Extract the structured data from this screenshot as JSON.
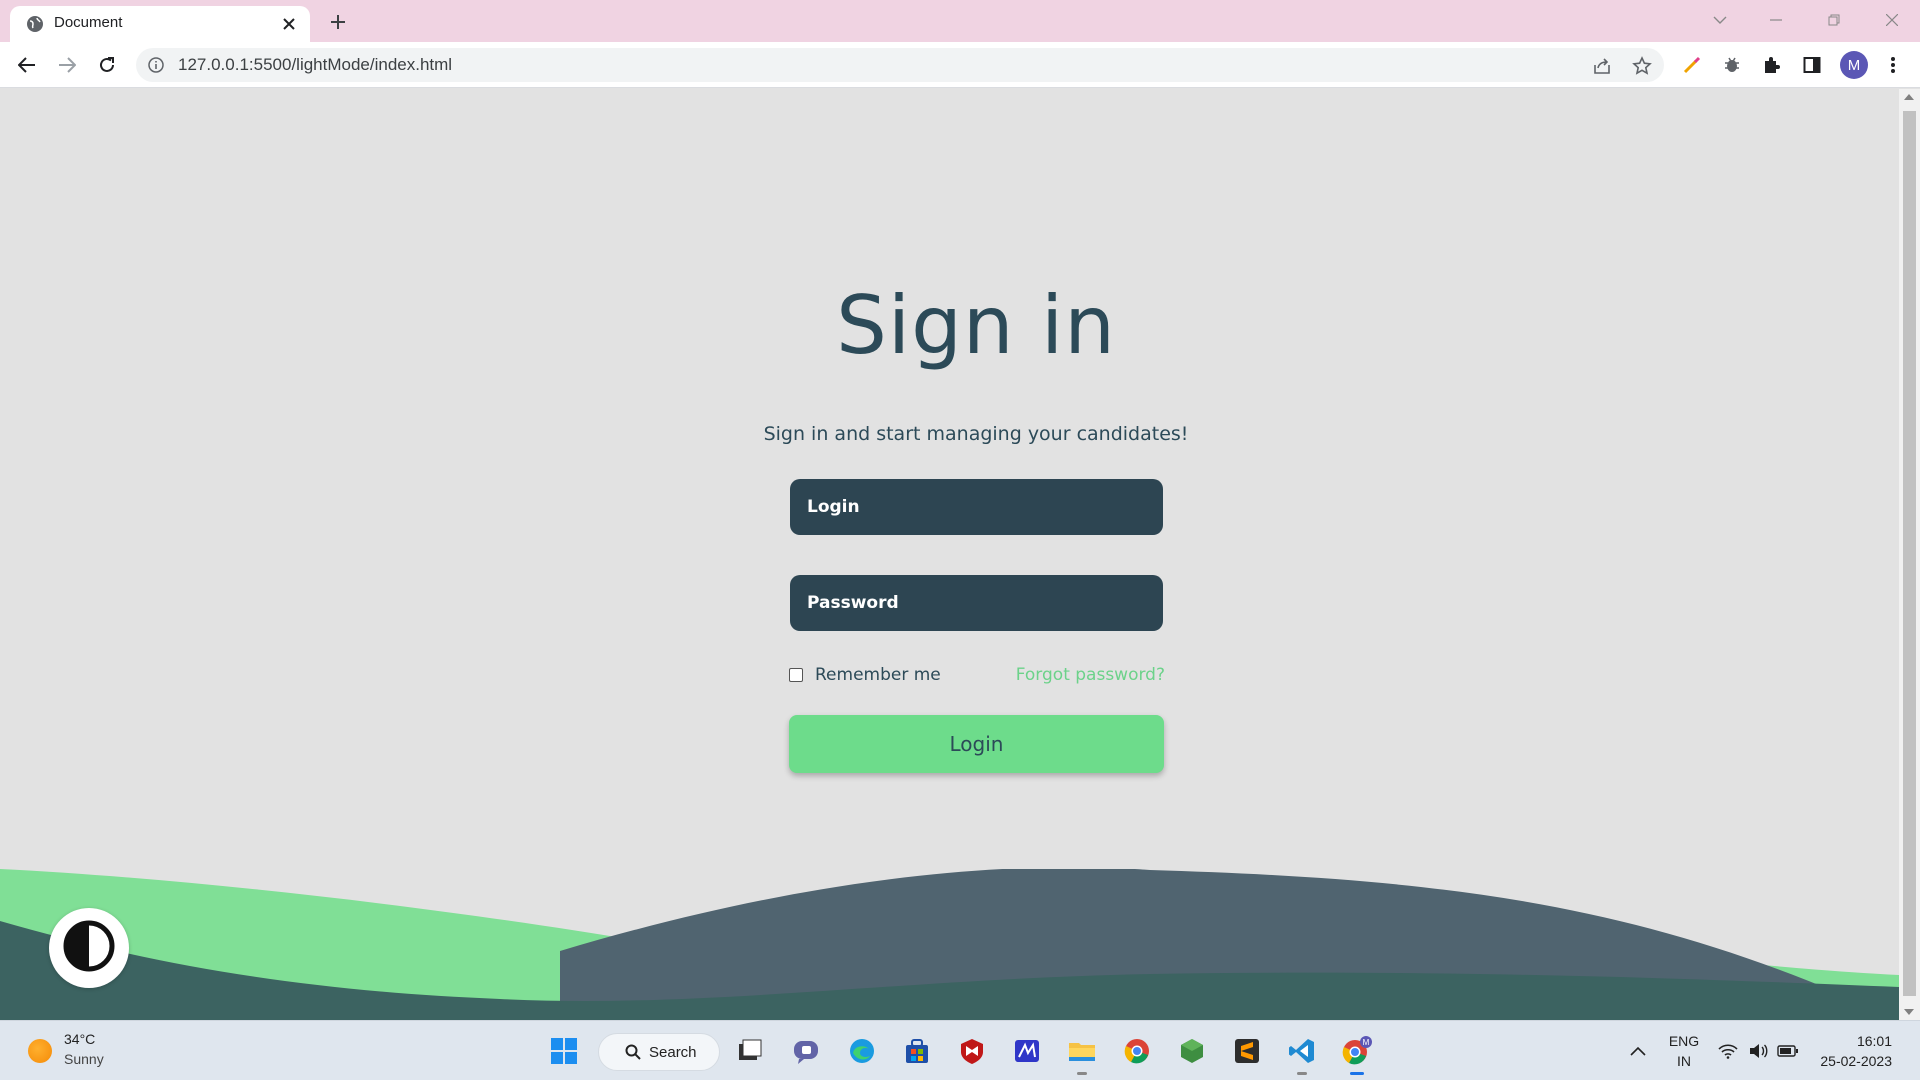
{
  "browser": {
    "tab_title": "Document",
    "url": "127.0.0.1:5500/lightMode/index.html",
    "profile_initial": "M"
  },
  "page": {
    "title": "Sign in",
    "subtitle": "Sign in and start managing your candidates!",
    "login_placeholder": "Login",
    "password_placeholder": "Password",
    "remember_label": "Remember me",
    "remember_checked": false,
    "forgot_label": "Forgot password?",
    "login_button": "Login"
  },
  "colors": {
    "primary_dark": "#2c4a58",
    "accent_green": "#6ddc8b",
    "background": "#e2e2e2"
  },
  "taskbar": {
    "weather_temp": "34°C",
    "weather_desc": "Sunny",
    "search_label": "Search",
    "lang_line1": "ENG",
    "lang_line2": "IN",
    "time": "16:01",
    "date": "25-02-2023"
  }
}
